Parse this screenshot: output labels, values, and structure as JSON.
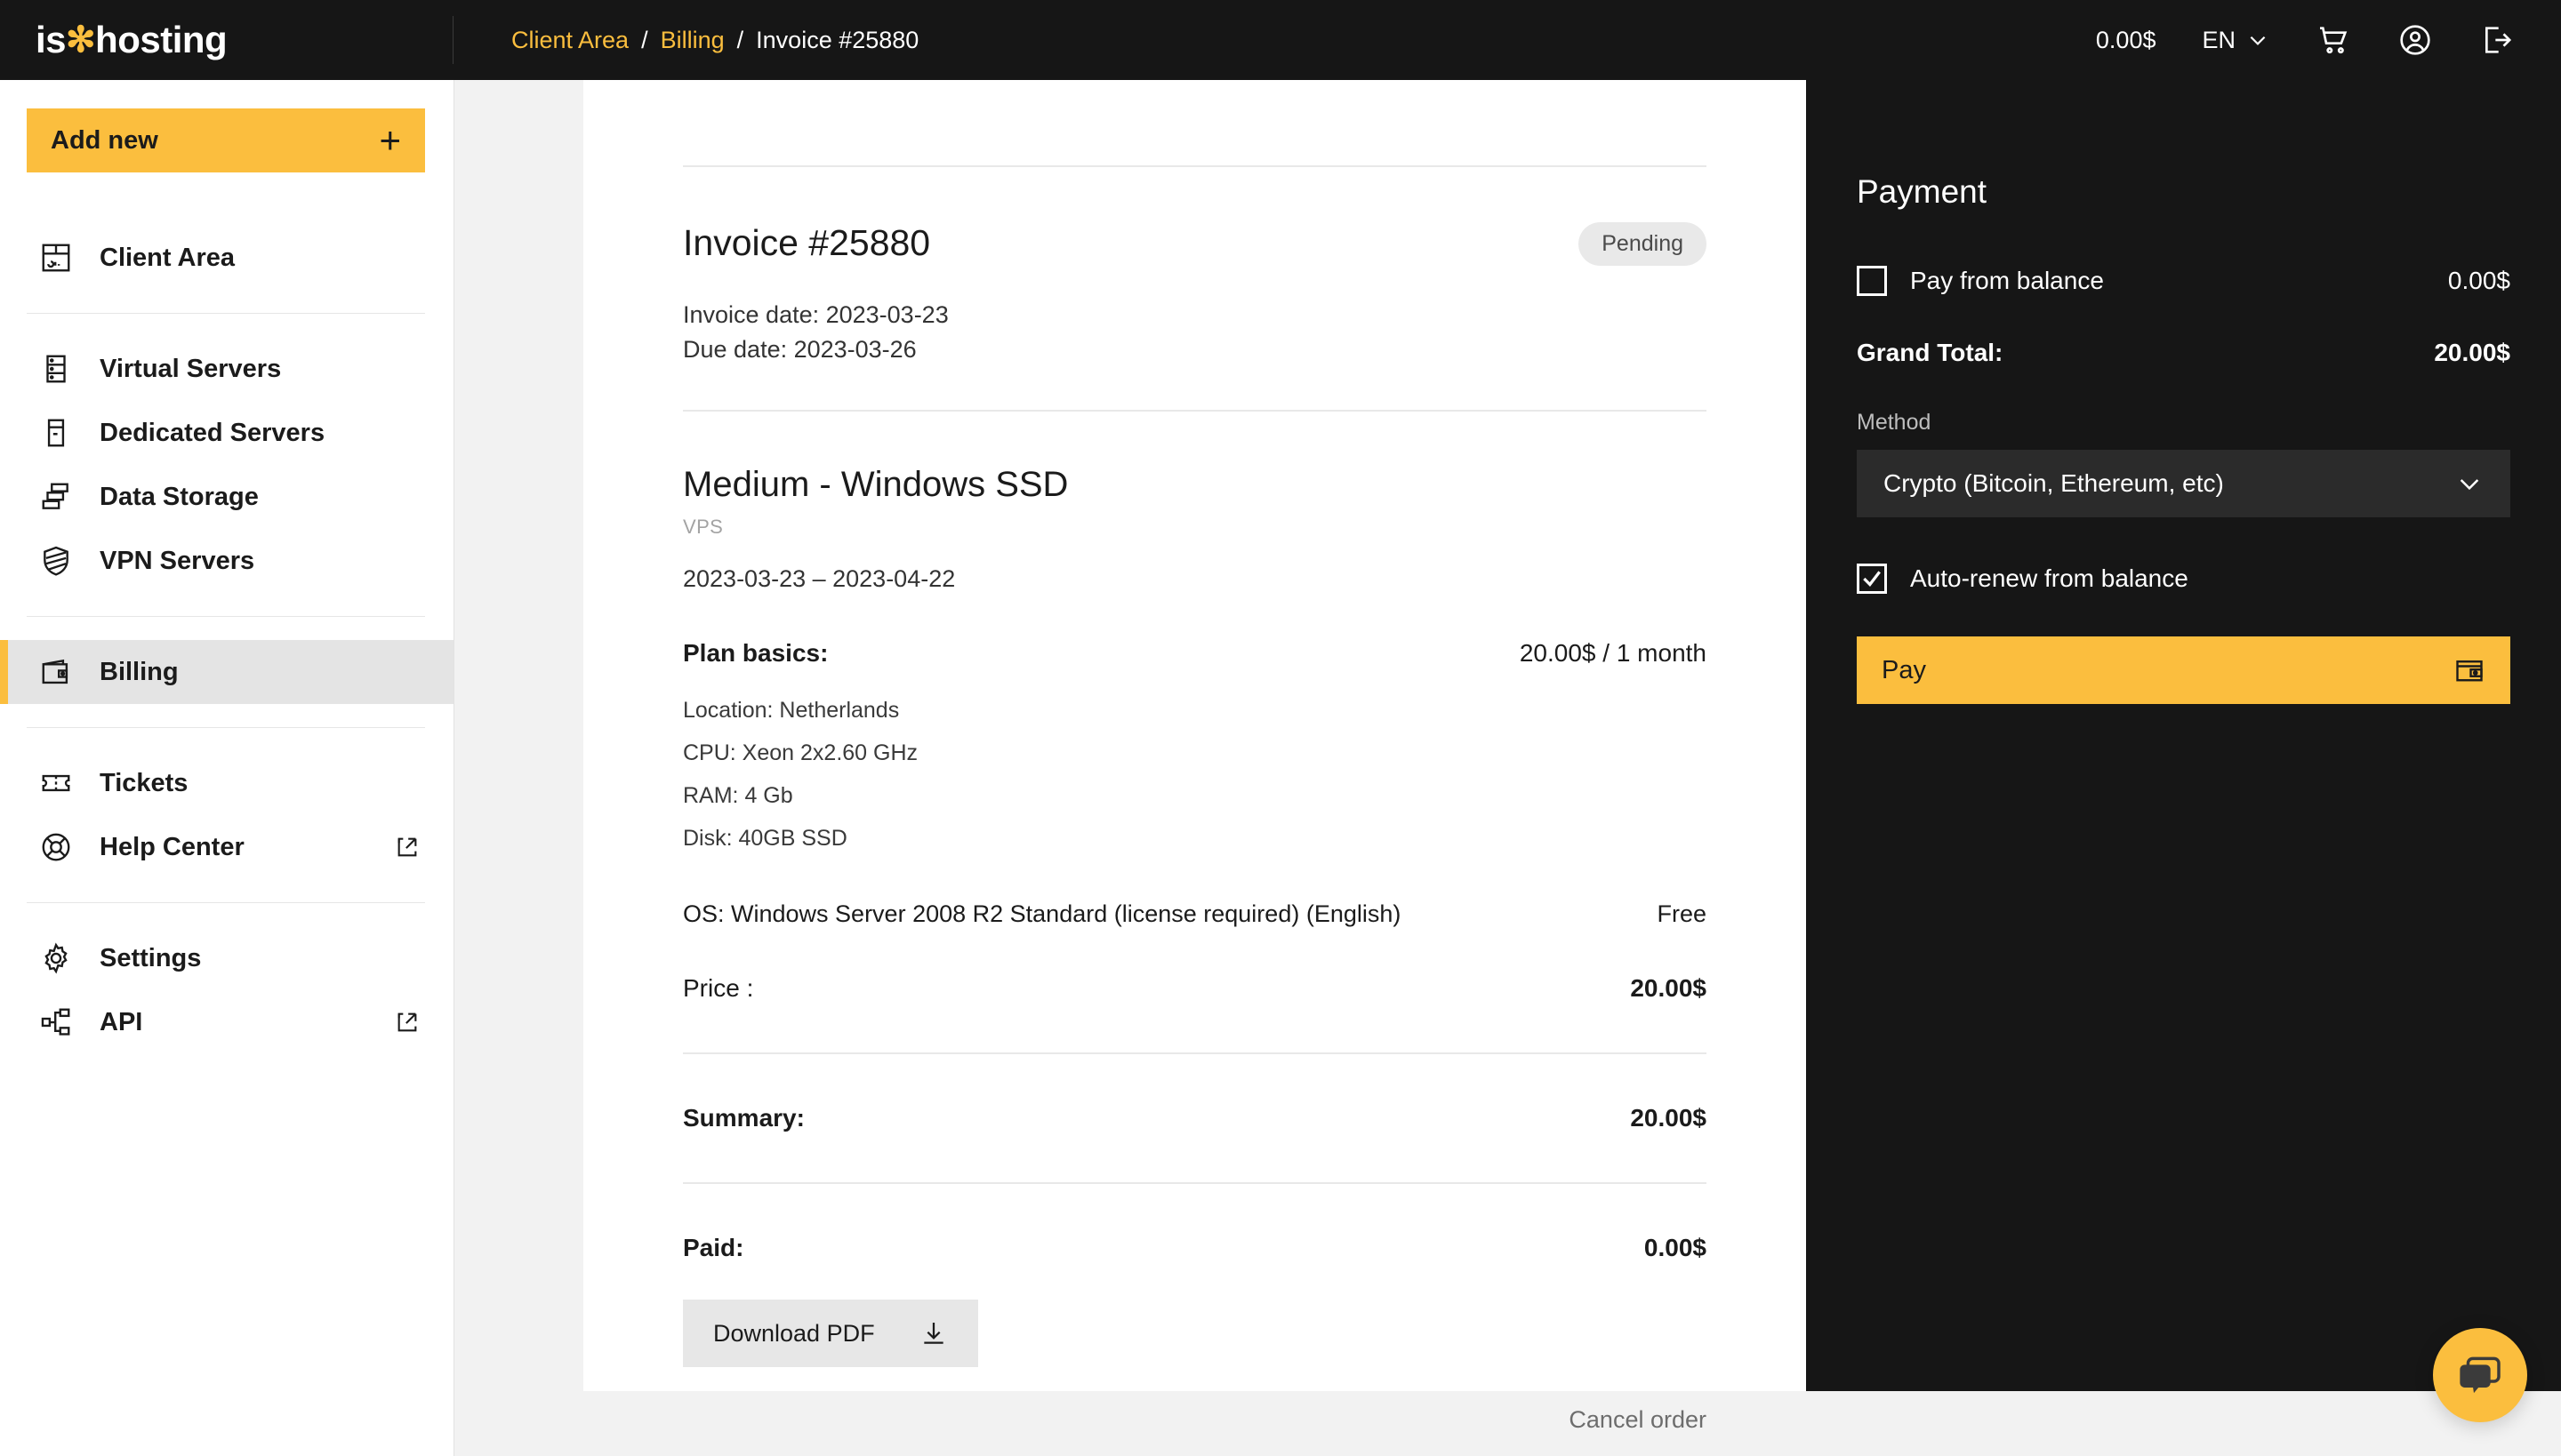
{
  "topbar": {
    "logo_text_1": "is",
    "logo_star": "✻",
    "logo_text_2": "hosting",
    "breadcrumb": {
      "client_area": "Client Area",
      "sep1": "/",
      "billing": "Billing",
      "sep2": "/",
      "current": "Invoice #25880"
    },
    "balance": "0.00$",
    "language": "EN",
    "icons": {
      "chevron": "chevron-down-icon",
      "cart": "cart-icon",
      "account": "account-icon",
      "logout": "logout-icon"
    }
  },
  "sidebar": {
    "add_new": "Add new",
    "add_new_plus": "+",
    "items": [
      {
        "label": "Client Area",
        "icon": "dashboard-icon",
        "external": false,
        "active": false
      },
      {
        "label": "Virtual Servers",
        "icon": "server-rack-icon",
        "external": false,
        "active": false
      },
      {
        "label": "Dedicated Servers",
        "icon": "server-tower-icon",
        "external": false,
        "active": false
      },
      {
        "label": "Data Storage",
        "icon": "database-stack-icon",
        "external": false,
        "active": false
      },
      {
        "label": "VPN Servers",
        "icon": "shield-icon",
        "external": false,
        "active": false
      },
      {
        "label": "Billing",
        "icon": "wallet-icon",
        "external": false,
        "active": true
      },
      {
        "label": "Tickets",
        "icon": "ticket-icon",
        "external": false,
        "active": false
      },
      {
        "label": "Help Center",
        "icon": "lifebuoy-icon",
        "external": true,
        "active": false
      },
      {
        "label": "Settings",
        "icon": "gear-icon",
        "external": false,
        "active": false
      },
      {
        "label": "API",
        "icon": "api-nodes-icon",
        "external": true,
        "active": false
      }
    ]
  },
  "invoice": {
    "title": "Invoice #25880",
    "status": "Pending",
    "invoice_date": "Invoice date: 2023-03-23",
    "due_date": "Due date: 2023-03-26",
    "plan_name": "Medium - Windows SSD",
    "plan_type": "VPS",
    "period": "2023-03-23 – 2023-04-22",
    "basics_label": "Plan basics:",
    "basics_price": "20.00$ / 1 month",
    "specs": [
      "Location: Netherlands",
      "CPU: Xeon 2x2.60 GHz",
      "RAM: 4 Gb",
      "Disk: 40GB SSD"
    ],
    "os_label": "OS: Windows Server 2008 R2 Standard (license required) (English)",
    "os_price": "Free",
    "price_label": "Price :",
    "price_value": "20.00$",
    "summary_label": "Summary:",
    "summary_value": "20.00$",
    "paid_label": "Paid:",
    "paid_value": "0.00$",
    "download_pdf": "Download PDF",
    "cancel_order": "Cancel order"
  },
  "payment": {
    "title": "Payment",
    "pay_from_balance_label": "Pay from balance",
    "pay_from_balance_value": "0.00$",
    "pay_from_balance_checked": false,
    "grand_total_label": "Grand Total:",
    "grand_total_value": "20.00$",
    "method_label": "Method",
    "method_selected": "Crypto (Bitcoin, Ethereum, etc)",
    "auto_renew_label": "Auto-renew from balance",
    "auto_renew_checked": true,
    "pay_button": "Pay"
  },
  "chat": {
    "icon": "chat-bubbles-icon"
  },
  "colors": {
    "accent": "#fbbe3e",
    "dark": "#161616",
    "page_bg": "#f2f2f2",
    "card": "#ffffff",
    "badge_bg": "#e9e9e9"
  }
}
